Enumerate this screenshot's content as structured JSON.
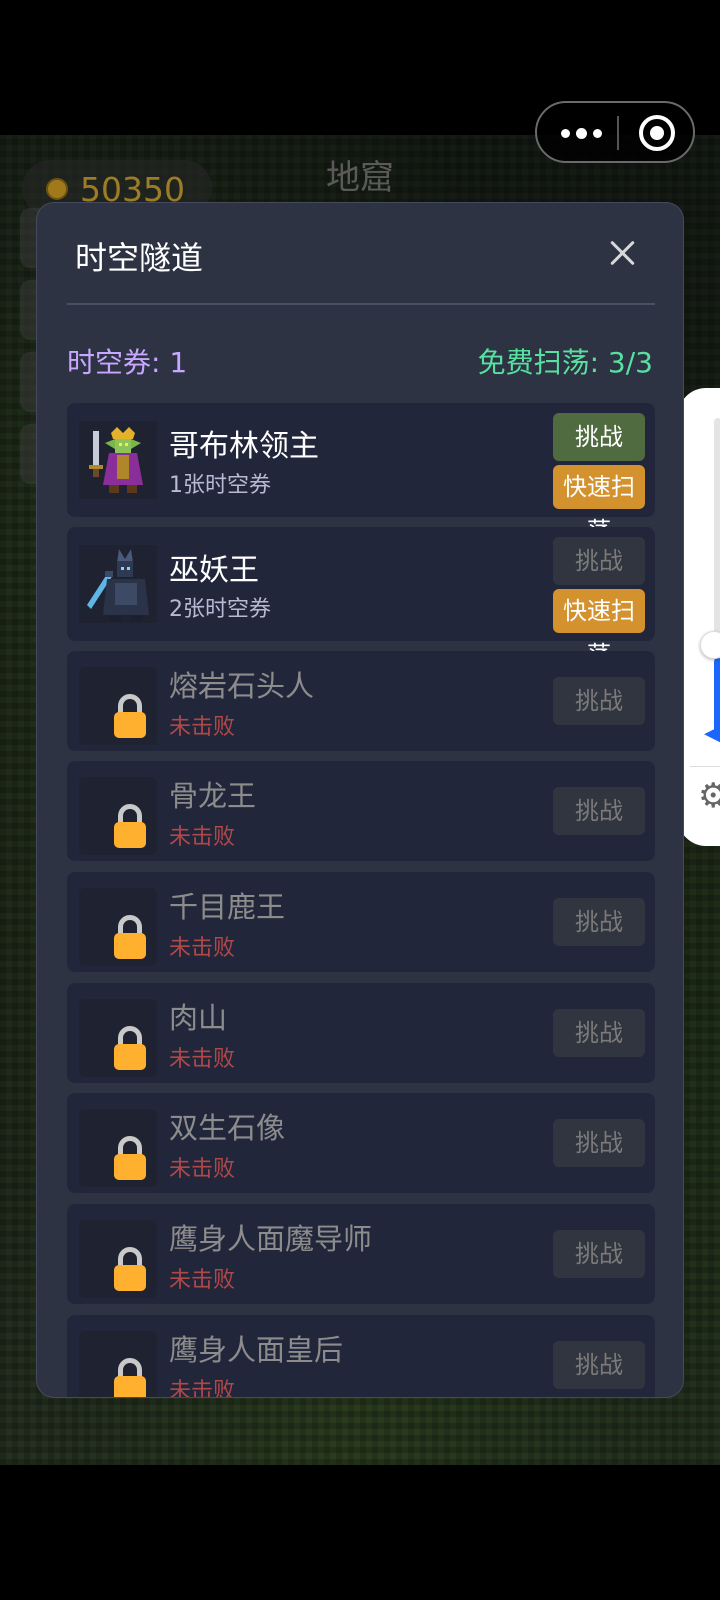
{
  "scene": {
    "title": "地窟",
    "coins": "50350"
  },
  "modal": {
    "title": "时空隧道",
    "ticket_count": "时空券: 1",
    "free_sweep": "免费扫荡: 3/3"
  },
  "bosses": [
    {
      "name": "哥布林领主",
      "sub": "1张时空券",
      "locked": false,
      "challenge": "挑战",
      "sweep": "快速扫荡",
      "challenge_enabled": true
    },
    {
      "name": "巫妖王",
      "sub": "2张时空券",
      "locked": false,
      "challenge": "挑战",
      "sweep": "快速扫荡",
      "challenge_enabled": false
    },
    {
      "name": "熔岩石头人",
      "sub": "未击败",
      "locked": true,
      "challenge": "挑战"
    },
    {
      "name": "骨龙王",
      "sub": "未击败",
      "locked": true,
      "challenge": "挑战"
    },
    {
      "name": "千目鹿王",
      "sub": "未击败",
      "locked": true,
      "challenge": "挑战"
    },
    {
      "name": "肉山",
      "sub": "未击败",
      "locked": true,
      "challenge": "挑战"
    },
    {
      "name": "双生石像",
      "sub": "未击败",
      "locked": true,
      "challenge": "挑战"
    },
    {
      "name": "鹰身人面魔导师",
      "sub": "未击败",
      "locked": true,
      "challenge": "挑战"
    },
    {
      "name": "鹰身人面皇后",
      "sub": "未击败",
      "locked": true,
      "challenge": "挑战"
    }
  ],
  "colors": {
    "challenge_active": "#4f6b3f",
    "sweep": "#d4922e",
    "disabled": "#31353f",
    "ticket": "#c7a7ff",
    "free": "#58e0a0",
    "undefeated": "#b04848",
    "lock": "#ffb02e"
  }
}
